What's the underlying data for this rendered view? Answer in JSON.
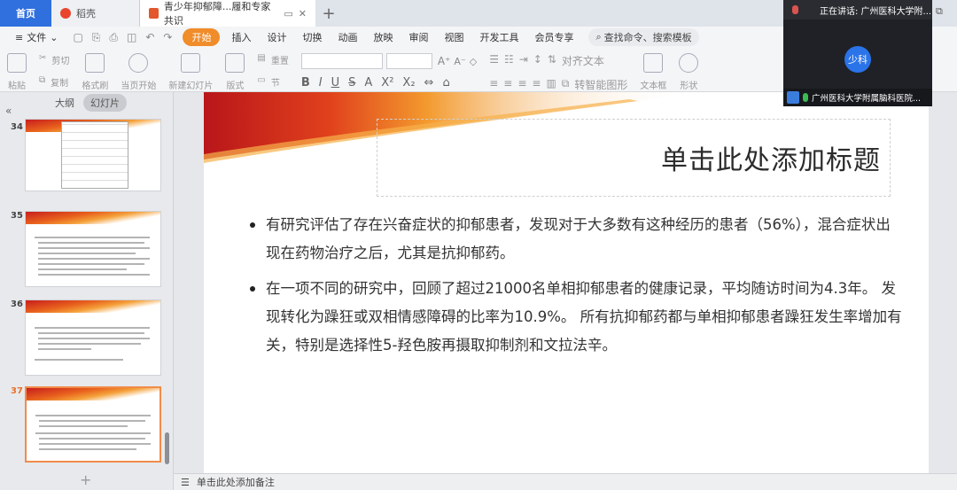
{
  "tabs": {
    "home": "首页",
    "shell": "稻壳",
    "document": "青少年抑郁障...履和专家共识",
    "add": "+"
  },
  "menu": {
    "file": "文件",
    "items": [
      "开始",
      "插入",
      "设计",
      "切换",
      "动画",
      "放映",
      "审阅",
      "视图",
      "开发工具",
      "会员专享"
    ],
    "active": "开始",
    "search": "查找命令、搜索模板"
  },
  "ribbon": {
    "paste": "粘贴",
    "cut": "剪切",
    "copy": "复制",
    "format_painter": "格式刷",
    "from_current": "当页开始",
    "new_slide": "新建幻灯片",
    "layout": "版式",
    "reset": "重置",
    "section": "节",
    "align_text": "对齐文本",
    "to_smartart": "转智能图形",
    "textbox": "文本框",
    "shape": "形状"
  },
  "left_panel": {
    "outline_tab": "大纲",
    "slides_tab": "幻灯片",
    "slides": [
      {
        "number": "34",
        "active": false
      },
      {
        "number": "35",
        "active": false
      },
      {
        "number": "36",
        "active": false
      },
      {
        "number": "37",
        "active": true
      }
    ]
  },
  "slide": {
    "title": "单击此处添加标题",
    "bullets": [
      "有研究评估了存在兴奋症状的抑郁患者，发现对于大多数有这种经历的患者（56%），混合症状出现在药物治疗之后，尤其是抗抑郁药。",
      "在一项不同的研究中，回顾了超过21000名单相抑郁患者的健康记录，平均随访时间为4.3年。 发现转化为躁狂或双相情感障碍的比率为10.9%。 所有抗抑郁药都与单相抑郁患者躁狂发生率增加有关，特别是选择性5-羟色胺再摄取抑制剂和文拉法辛。"
    ]
  },
  "notes": {
    "placeholder": "单击此处添加备注"
  },
  "meeting": {
    "speaking": "正在讲话: 广州医科大学附...",
    "avatar_name": "少科",
    "participant": "广州医科大学附属脑科医院..."
  }
}
